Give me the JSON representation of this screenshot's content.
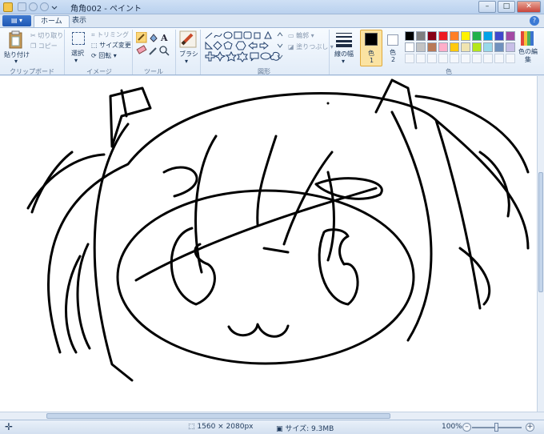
{
  "window": {
    "title": "角角002 - ペイント",
    "controls": {
      "minimize": "–",
      "maximize": "□",
      "close": "✕"
    }
  },
  "ribbon_tabs": {
    "app_menu": "▤ ▾",
    "home": "ホーム",
    "view": "表示",
    "help": "?"
  },
  "ribbon": {
    "clipboard": {
      "paste": "貼り付け",
      "cut": "切り取り",
      "copy": "コピー",
      "group": "クリップボード"
    },
    "image": {
      "select": "選択",
      "crop": "トリミング",
      "resize": "サイズ変更",
      "rotate": "回転 ▾",
      "group": "イメージ"
    },
    "tools": {
      "group": "ツール"
    },
    "brushes": {
      "label": "ブラシ"
    },
    "shapes": {
      "outline": "輪郭 ▾",
      "fill": "塗りつぶし ▾",
      "group": "図形"
    },
    "size": {
      "label": "線の幅"
    },
    "colors": {
      "color1": "色",
      "color1_num": "1",
      "color2": "色",
      "color2_num": "2",
      "edit_colors": "色の編集",
      "group": "色",
      "palette_row1": [
        "#000000",
        "#7f7f7f",
        "#880015",
        "#ed1c24",
        "#ff7f27",
        "#fff200",
        "#22b14c",
        "#00a2e8",
        "#3f48cc",
        "#a349a4"
      ],
      "palette_row2": [
        "#ffffff",
        "#c3c3c3",
        "#b97a57",
        "#ffaec9",
        "#ffc90e",
        "#efe4b0",
        "#b5e61d",
        "#99d9ea",
        "#7092be",
        "#c8bfe7"
      ]
    }
  },
  "status": {
    "dimensions": "1560 × 2080px",
    "filesize": "サイズ: 9.3MB",
    "zoom": "100%"
  }
}
